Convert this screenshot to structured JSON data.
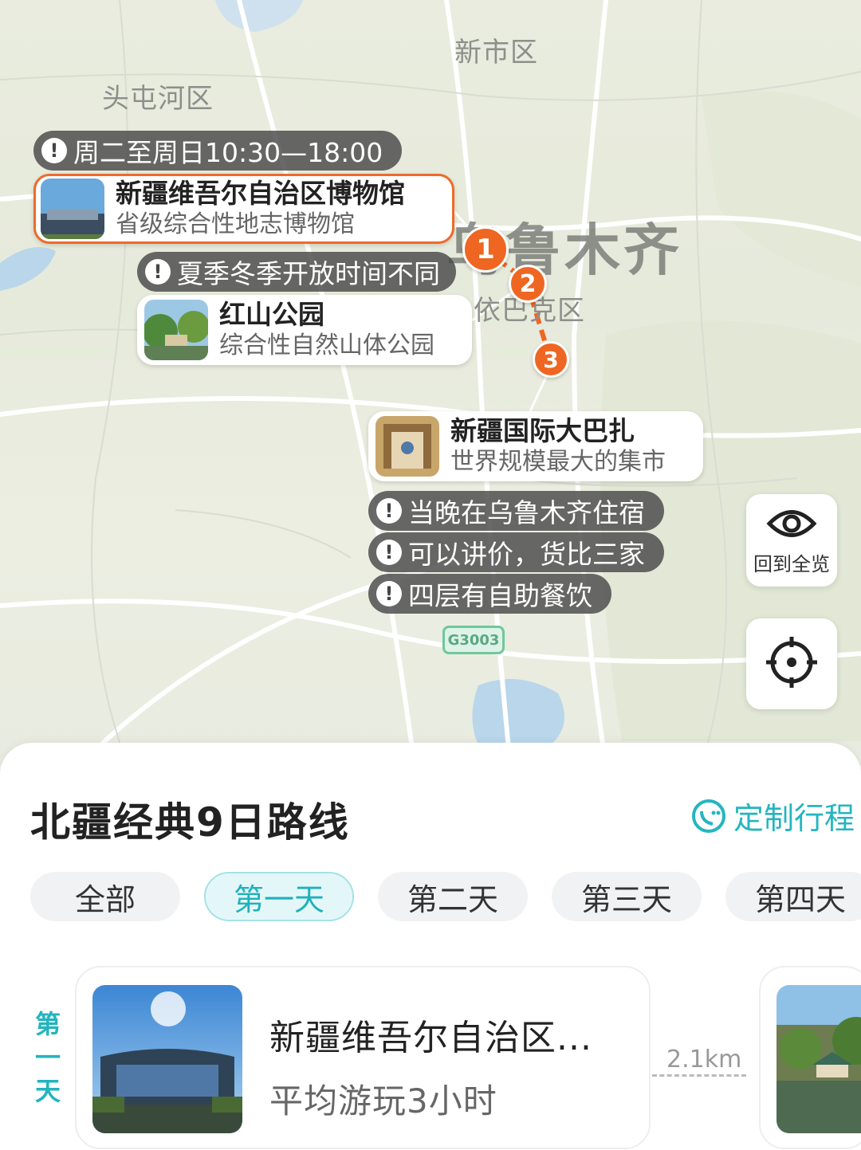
{
  "map": {
    "districts": [
      "新市区",
      "头屯河区",
      "依巴克区"
    ],
    "city": "乌鲁木齐",
    "highway": "G3003",
    "stops": [
      {
        "number": "1",
        "name": "新疆维吾尔自治区博物馆",
        "desc": "省级综合性地志博物馆",
        "tip": "周二至周日10:30—18:00"
      },
      {
        "number": "2",
        "name": "红山公园",
        "desc": "综合性自然山体公园",
        "tip": "夏季冬季开放时间不同"
      },
      {
        "number": "3",
        "name": "新疆国际大巴扎",
        "desc": "世界规模最大的集市",
        "tips": [
          "当晚在乌鲁木齐住宿",
          "可以讲价，货比三家",
          "四层有自助餐饮"
        ]
      }
    ],
    "overview_button": {
      "label": "回到全览",
      "icon": "eye-icon"
    },
    "locate_button": {
      "icon": "crosshair-icon"
    }
  },
  "panel": {
    "title": "北疆经典9日路线",
    "custom_label": "定制行程",
    "tabs": [
      "全部",
      "第一天",
      "第二天",
      "第三天",
      "第四天"
    ],
    "active_tab": "第一天",
    "day_label": [
      "第",
      "一",
      "天"
    ],
    "place_card": {
      "name": "新疆维吾尔自治区...",
      "duration": "平均游玩3小时"
    },
    "distance": "2.1km"
  },
  "colors": {
    "accent": "#1fb1bd",
    "marker": "#ef6622"
  }
}
